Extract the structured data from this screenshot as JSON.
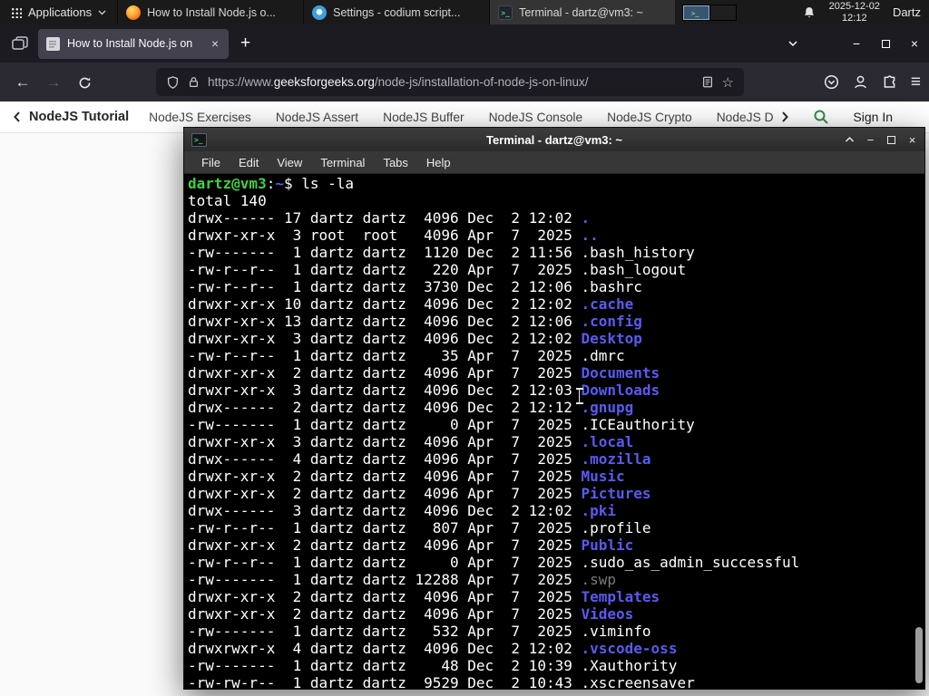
{
  "panel": {
    "applications_label": "Applications",
    "taskbar": [
      {
        "title": "How to Install Node.js o...",
        "icon": "firefox",
        "active": false
      },
      {
        "title": "Settings - codium script...",
        "icon": "settings",
        "active": false
      },
      {
        "title": "Terminal - dartz@vm3: ~",
        "icon": "terminal",
        "active": true
      }
    ],
    "clock": {
      "date": "2025-12-02",
      "time": "12:12"
    },
    "user_label": "Dartz"
  },
  "browser": {
    "tab": {
      "title": "How to Install Node.js on"
    },
    "urlbar": {
      "scheme": "https://www.",
      "domain": "geeksforgeeks.org",
      "path": "/node-js/installation-of-node-js-on-linux/"
    }
  },
  "site_nav": {
    "primary": "NodeJS Tutorial",
    "items": [
      "NodeJS Exercises",
      "NodeJS Assert",
      "NodeJS Buffer",
      "NodeJS Console",
      "NodeJS Crypto",
      "NodeJS DNS",
      "Node"
    ],
    "sign_in": "Sign In"
  },
  "terminal": {
    "title": "Terminal - dartz@vm3: ~",
    "menus": [
      "File",
      "Edit",
      "View",
      "Terminal",
      "Tabs",
      "Help"
    ],
    "lines": [
      [
        [
          "dartz@vm3",
          "g"
        ],
        [
          ":",
          "w"
        ],
        [
          "~",
          "b"
        ],
        [
          "$ ",
          "w"
        ],
        [
          "ls -la",
          "w"
        ]
      ],
      [
        [
          "total 140",
          "w"
        ]
      ],
      [
        [
          "drwx------ 17 dartz dartz  4096 Dec  2 12:02 ",
          "w"
        ],
        [
          ".",
          "b"
        ]
      ],
      [
        [
          "drwxr-xr-x  3 root  root   4096 Apr  7  2025 ",
          "w"
        ],
        [
          "..",
          "b"
        ]
      ],
      [
        [
          "-rw-------  1 dartz dartz  1120 Dec  2 11:56 .bash_history",
          "w"
        ]
      ],
      [
        [
          "-rw-r--r--  1 dartz dartz   220 Apr  7  2025 .bash_logout",
          "w"
        ]
      ],
      [
        [
          "-rw-r--r--  1 dartz dartz  3730 Dec  2 12:06 .bashrc",
          "w"
        ]
      ],
      [
        [
          "drwxr-xr-x 10 dartz dartz  4096 Dec  2 12:02 ",
          "w"
        ],
        [
          ".cache",
          "b"
        ]
      ],
      [
        [
          "drwxr-xr-x 13 dartz dartz  4096 Dec  2 12:06 ",
          "w"
        ],
        [
          ".config",
          "b"
        ]
      ],
      [
        [
          "drwxr-xr-x  3 dartz dartz  4096 Dec  2 12:02 ",
          "w"
        ],
        [
          "Desktop",
          "b"
        ]
      ],
      [
        [
          "-rw-r--r--  1 dartz dartz    35 Apr  7  2025 .dmrc",
          "w"
        ]
      ],
      [
        [
          "drwxr-xr-x  2 dartz dartz  4096 Apr  7  2025 ",
          "w"
        ],
        [
          "Documents",
          "b"
        ]
      ],
      [
        [
          "drwxr-xr-x  3 dartz dartz  4096 Dec  2 12:03 ",
          "w"
        ],
        [
          "Downloads",
          "b"
        ]
      ],
      [
        [
          "drwx------  2 dartz dartz  4096 Dec  2 12:12 ",
          "w"
        ],
        [
          ".gnupg",
          "b"
        ]
      ],
      [
        [
          "-rw-------  1 dartz dartz     0 Apr  7  2025 .ICEauthority",
          "w"
        ]
      ],
      [
        [
          "drwxr-xr-x  3 dartz dartz  4096 Apr  7  2025 ",
          "w"
        ],
        [
          ".local",
          "b"
        ]
      ],
      [
        [
          "drwx------  4 dartz dartz  4096 Apr  7  2025 ",
          "w"
        ],
        [
          ".mozilla",
          "b"
        ]
      ],
      [
        [
          "drwxr-xr-x  2 dartz dartz  4096 Apr  7  2025 ",
          "w"
        ],
        [
          "Music",
          "b"
        ]
      ],
      [
        [
          "drwxr-xr-x  2 dartz dartz  4096 Apr  7  2025 ",
          "w"
        ],
        [
          "Pictures",
          "b"
        ]
      ],
      [
        [
          "drwx------  3 dartz dartz  4096 Dec  2 12:02 ",
          "w"
        ],
        [
          ".pki",
          "b"
        ]
      ],
      [
        [
          "-rw-r--r--  1 dartz dartz   807 Apr  7  2025 .profile",
          "w"
        ]
      ],
      [
        [
          "drwxr-xr-x  2 dartz dartz  4096 Apr  7  2025 ",
          "w"
        ],
        [
          "Public",
          "b"
        ]
      ],
      [
        [
          "-rw-r--r--  1 dartz dartz     0 Apr  7  2025 .sudo_as_admin_successful",
          "w"
        ]
      ],
      [
        [
          "-rw-------  1 dartz dartz 12288 Apr  7  2025 ",
          "w"
        ],
        [
          ".swp",
          "d"
        ]
      ],
      [
        [
          "drwxr-xr-x  2 dartz dartz  4096 Apr  7  2025 ",
          "w"
        ],
        [
          "Templates",
          "b"
        ]
      ],
      [
        [
          "drwxr-xr-x  2 dartz dartz  4096 Apr  7  2025 ",
          "w"
        ],
        [
          "Videos",
          "b"
        ]
      ],
      [
        [
          "-rw-------  1 dartz dartz   532 Apr  7  2025 .viminfo",
          "w"
        ]
      ],
      [
        [
          "drwxrwxr-x  4 dartz dartz  4096 Dec  2 12:02 ",
          "w"
        ],
        [
          ".vscode-oss",
          "b"
        ]
      ],
      [
        [
          "-rw-------  1 dartz dartz    48 Dec  2 10:39 .Xauthority",
          "w"
        ]
      ],
      [
        [
          "-rw-rw-r--  1 dartz dartz  9529 Dec  2 10:43 .xscreensaver",
          "w"
        ]
      ]
    ]
  }
}
